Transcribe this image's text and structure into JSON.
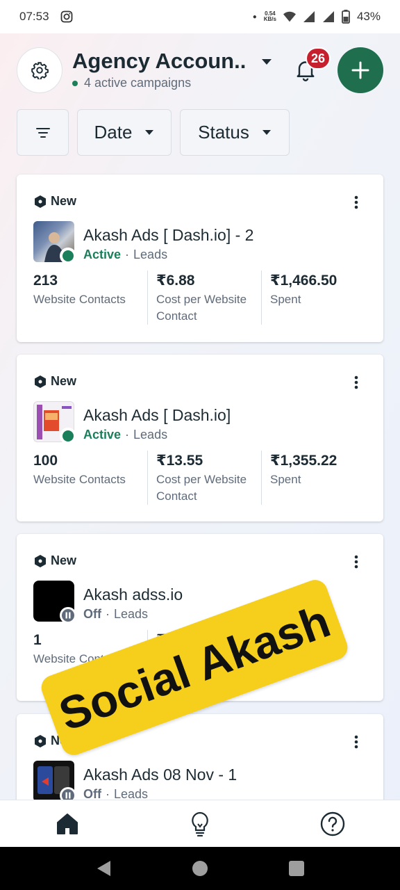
{
  "status_bar": {
    "time": "07:53",
    "net_speed_value": "0.54",
    "net_speed_unit": "KB/s",
    "battery": "43%"
  },
  "header": {
    "account_name": "Agency Accoun..",
    "subtitle": "4 active campaigns",
    "notification_count": "26"
  },
  "filters": {
    "date_label": "Date",
    "status_label": "Status"
  },
  "campaigns": [
    {
      "tag": "New",
      "name": "Akash Ads [ Dash.io] - 2",
      "status": "Active",
      "objective": "Leads",
      "metrics": [
        {
          "value": "213",
          "label": "Website Contacts"
        },
        {
          "value": "₹6.88",
          "label": "Cost per Website Contact"
        },
        {
          "value": "₹1,466.50",
          "label": "Spent"
        }
      ]
    },
    {
      "tag": "New",
      "name": "Akash Ads [ Dash.io]",
      "status": "Active",
      "objective": "Leads",
      "metrics": [
        {
          "value": "100",
          "label": "Website Contacts"
        },
        {
          "value": "₹13.55",
          "label": "Cost per Website Contact"
        },
        {
          "value": "₹1,355.22",
          "label": "Spent"
        }
      ]
    },
    {
      "tag": "New",
      "name": "Akash adss.io",
      "status": "Off",
      "objective": "Leads",
      "metrics": [
        {
          "value": "1",
          "label": "Website Contacts"
        },
        {
          "value": "₹3",
          "label": ""
        },
        {
          "value": "",
          "label": ""
        }
      ]
    },
    {
      "tag": "New",
      "name": "Akash Ads 08 Nov - 1",
      "status": "Off",
      "objective": "Leads"
    }
  ],
  "watermark": "Social Akash",
  "colors": {
    "accent_green": "#1f6e4e",
    "active_green": "#1a7f5a",
    "badge_red": "#c6202e",
    "watermark_yellow": "#f5cf1b"
  }
}
